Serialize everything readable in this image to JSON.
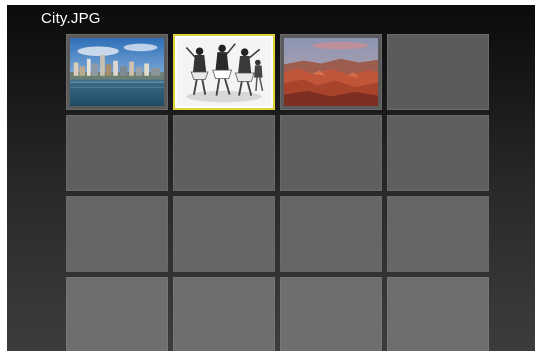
{
  "header": {
    "filename": "City.JPG"
  },
  "thumbnails": [
    {
      "icon": "city-skyline-photo",
      "selected": false
    },
    {
      "icon": "dancers-photo",
      "selected": true
    },
    {
      "icon": "canyon-photo",
      "selected": false
    }
  ],
  "colors": {
    "selection": "#e0d23a",
    "background_top": "#0b0b0b",
    "background_bottom": "#3e3b3c",
    "empty_cell": "#5b5b5b"
  }
}
